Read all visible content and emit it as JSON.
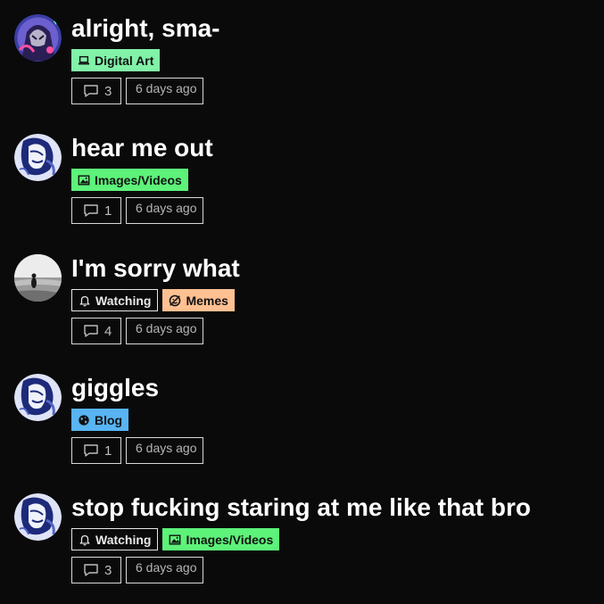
{
  "threads": [
    {
      "title": "alright, sma-",
      "avatar": "purple-hooded-character-avatar",
      "tags": [
        {
          "label": "Digital Art",
          "type": "digital",
          "icon": "laptop-icon"
        }
      ],
      "replies": "3",
      "time": "6 days ago"
    },
    {
      "title": "hear me out",
      "avatar": "blue-sketch-character-avatar",
      "tags": [
        {
          "label": "Images/Videos",
          "type": "images",
          "icon": "image-icon"
        }
      ],
      "replies": "1",
      "time": "6 days ago"
    },
    {
      "title": "I'm sorry what",
      "avatar": "grayscale-beach-photo-avatar",
      "tags": [
        {
          "label": "Watching",
          "type": "watching",
          "icon": "bell-icon"
        },
        {
          "label": "Memes",
          "type": "memes",
          "icon": "no-smile-icon"
        }
      ],
      "replies": "4",
      "time": "6 days ago"
    },
    {
      "title": "giggles",
      "avatar": "blue-sketch-character-avatar",
      "tags": [
        {
          "label": "Blog",
          "type": "blog",
          "icon": "globe-icon"
        }
      ],
      "replies": "1",
      "time": "6 days ago"
    },
    {
      "title": "stop fucking staring at me like that bro",
      "avatar": "blue-sketch-character-avatar",
      "tags": [
        {
          "label": "Watching",
          "type": "watching",
          "icon": "bell-icon"
        },
        {
          "label": "Images/Videos",
          "type": "images",
          "icon": "image-icon"
        }
      ],
      "replies": "3",
      "time": "6 days ago"
    }
  ],
  "colors": {
    "background": "#0a0a0a",
    "digital_art": "#82f2a8",
    "images_videos": "#5df27a",
    "memes": "#ffc092",
    "blog": "#58b4f2"
  }
}
